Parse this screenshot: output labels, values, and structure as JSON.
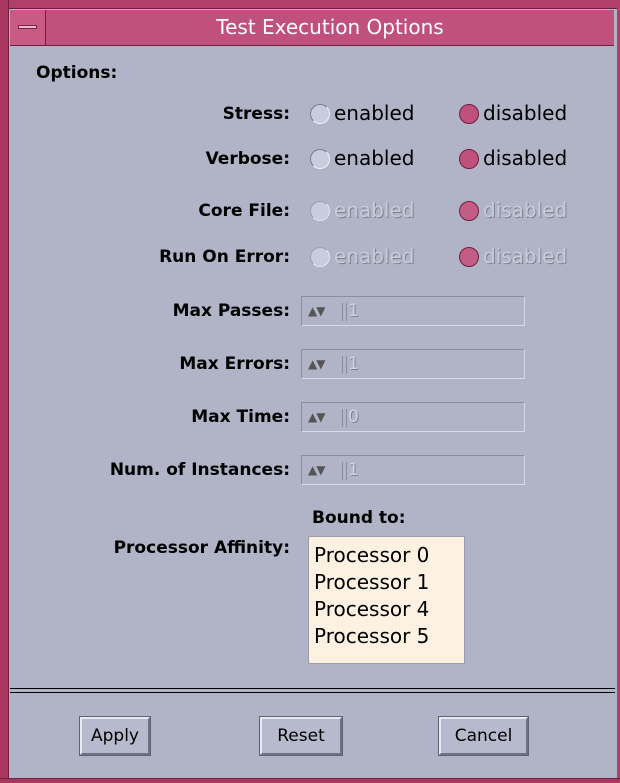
{
  "window": {
    "title": "Test Execution Options"
  },
  "options_header": "Options:",
  "radio_rows": [
    {
      "label": "Stress:",
      "option_a": "enabled",
      "option_b": "disabled",
      "selected": "disabled",
      "disabled": false
    },
    {
      "label": "Verbose:",
      "option_a": "enabled",
      "option_b": "disabled",
      "selected": "disabled",
      "disabled": false
    },
    {
      "label": "Core File:",
      "option_a": "enabled",
      "option_b": "disabled",
      "selected": "disabled",
      "disabled": true
    },
    {
      "label": "Run On Error:",
      "option_a": "enabled",
      "option_b": "disabled",
      "selected": "disabled",
      "disabled": true
    }
  ],
  "spin_fields": [
    {
      "label": "Max Passes:",
      "value": "1"
    },
    {
      "label": "Max Errors:",
      "value": "1"
    },
    {
      "label": "Max Time:",
      "value": "0"
    },
    {
      "label": "Num. of Instances:",
      "value": "1"
    }
  ],
  "affinity": {
    "label": "Processor Affinity:",
    "bound_label": "Bound to:",
    "items": [
      "Processor 0",
      "Processor 1",
      "Processor 4",
      "Processor 5"
    ]
  },
  "buttons": {
    "apply": "Apply",
    "reset": "Reset",
    "cancel": "Cancel"
  },
  "colors": {
    "background": "#b0b4c6",
    "accent": "#c0517c",
    "list_background": "#fdf2e2"
  },
  "icons": {
    "window_menu": "window-menu-icon",
    "spin_arrows": "up-down-arrows-icon"
  }
}
